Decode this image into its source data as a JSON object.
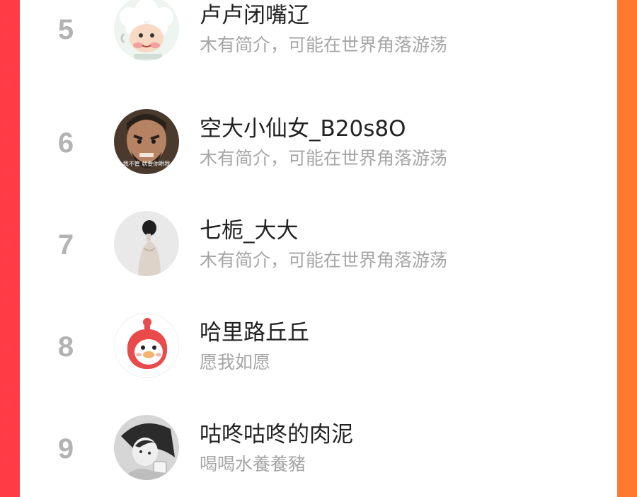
{
  "leaderboard": {
    "entries": [
      {
        "rank": "5",
        "name": "卢卢闭嘴辽",
        "bio": "木有简介，可能在世界角落游荡",
        "avatar_icon": "cartoon-sheep-avatar-icon"
      },
      {
        "rank": "6",
        "name": "空大小仙女_B20s8O",
        "bio": "木有简介，可能在世界角落游荡",
        "avatar_icon": "angry-man-meme-avatar-icon",
        "avatar_caption": "我不管 就要你哄我"
      },
      {
        "rank": "7",
        "name": "七栀_大大",
        "bio": "木有简介，可能在世界角落游荡",
        "avatar_icon": "woman-silhouette-avatar-icon"
      },
      {
        "rank": "8",
        "name": "哈里路丘丘",
        "bio": "愿我如愿",
        "avatar_icon": "red-duck-avatar-icon"
      },
      {
        "rank": "9",
        "name": "咕咚咕咚的肉泥",
        "bio": "喝喝水養養豬",
        "avatar_icon": "bw-girl-photo-avatar-icon"
      }
    ]
  },
  "colors": {
    "background_left": "#ff3b47",
    "background_right": "#ff7a2e",
    "rank": "#b3b3b3",
    "name": "#222222",
    "bio": "#a6a6a6",
    "duck_red": "#e94b4b"
  }
}
